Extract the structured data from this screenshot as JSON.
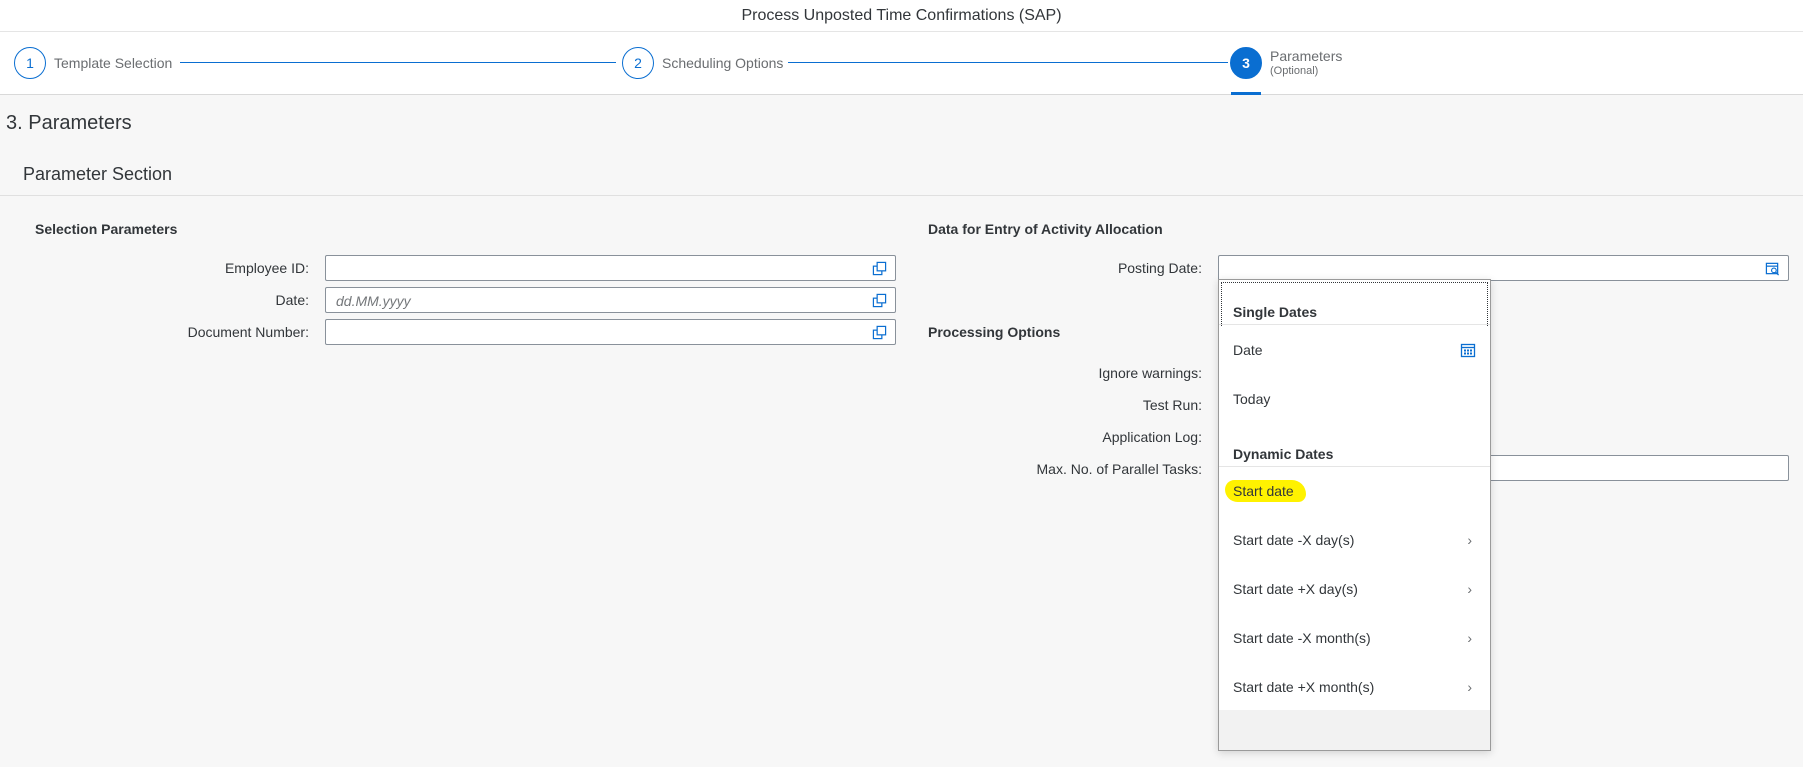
{
  "window": {
    "title": "Process Unposted Time Confirmations (SAP)"
  },
  "wizard": {
    "steps": [
      {
        "number": "1",
        "label": "Template Selection",
        "sub": ""
      },
      {
        "number": "2",
        "label": "Scheduling Options",
        "sub": ""
      },
      {
        "number": "3",
        "label": "Parameters",
        "sub": "(Optional)"
      }
    ],
    "active_step": 3
  },
  "page": {
    "title": "3. Parameters",
    "section": "Parameter Section"
  },
  "selection": {
    "title": "Selection Parameters",
    "employee_label": "Employee ID:",
    "employee_value": "",
    "date_label": "Date:",
    "date_placeholder": "dd.MM.yyyy",
    "docnum_label": "Document Number:",
    "docnum_value": ""
  },
  "activity": {
    "title": "Data for Entry of Activity Allocation",
    "posting_label": "Posting Date:",
    "posting_value": ""
  },
  "processing": {
    "title": "Processing Options",
    "ignore_label": "Ignore warnings:",
    "test_label": "Test Run:",
    "applog_label": "Application Log:",
    "parallel_label": "Max. No. of Parallel Tasks:",
    "parallel_value": ""
  },
  "date_menu": {
    "single_title": "Single Dates",
    "single_items": [
      "Date",
      "Today"
    ],
    "dynamic_title": "Dynamic Dates",
    "dynamic_items": [
      "Start date",
      "Start date -X day(s)",
      "Start date +X day(s)",
      "Start date -X month(s)",
      "Start date +X month(s)"
    ],
    "highlighted_item": "Start date"
  },
  "colors": {
    "accent": "#0a6ed1",
    "highlight": "#fff200"
  }
}
